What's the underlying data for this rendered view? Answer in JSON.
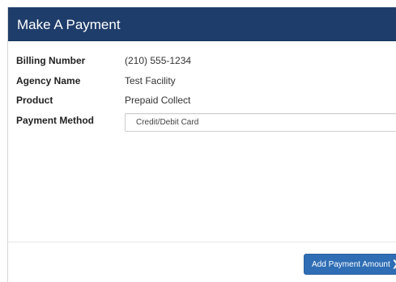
{
  "modal": {
    "title": "Make A Payment"
  },
  "fields": [
    {
      "label": "Billing Number",
      "value": "(210) 555-1234"
    },
    {
      "label": "Agency Name",
      "value": "Test Facility"
    },
    {
      "label": "Product",
      "value": "Prepaid Collect"
    }
  ],
  "payment_method": {
    "label": "Payment Method",
    "selected": "Credit/Debit Card"
  },
  "footer": {
    "primary_button_label": "Add Payment Amount",
    "primary_button_icon": "chevron-right-icon",
    "primary_button_glyph": "❯"
  },
  "colors": {
    "header_background": "#1f3d6a",
    "primary_button": "#2f6eb5"
  }
}
